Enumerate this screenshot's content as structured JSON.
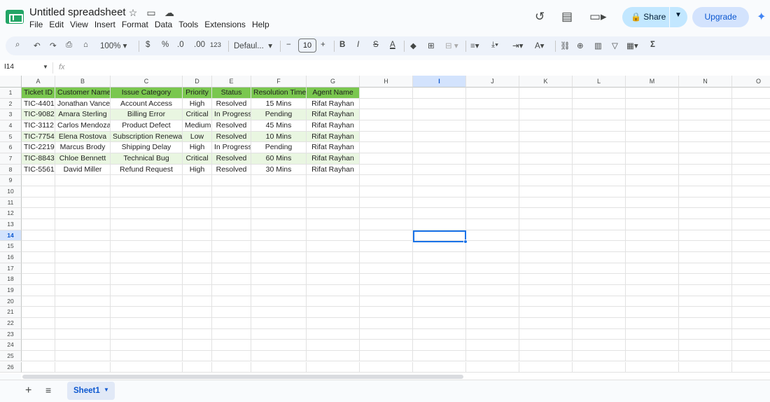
{
  "app": {
    "title": "Untitled spreadsheet",
    "icons": [
      "star-icon",
      "move-to-folder-icon",
      "cloud-saved-icon"
    ],
    "menu": [
      "File",
      "Edit",
      "View",
      "Insert",
      "Format",
      "Data",
      "Tools",
      "Extensions",
      "Help"
    ],
    "share_label": "Share",
    "upgrade_label": "Upgrade",
    "brand_color": "#23a566",
    "accent_color": "#0b57d0"
  },
  "toolbar": {
    "zoom": "100%",
    "currency": "$",
    "percent": "%",
    "dec_decrease": ".0",
    "dec_increase": ".00",
    "number_format": "123",
    "font": "Defaul...",
    "font_size": "10",
    "minus": "−",
    "plus": "+",
    "bold": "B",
    "italic": "I",
    "strike": "S",
    "text_color": "A",
    "sum": "Σ"
  },
  "formula_bar": {
    "name_box": "I14",
    "fx": "fx",
    "value": ""
  },
  "grid": {
    "columns": [
      "A",
      "B",
      "C",
      "D",
      "E",
      "F",
      "G",
      "H",
      "I",
      "J",
      "K",
      "L",
      "M",
      "N",
      "O"
    ],
    "rows": [
      "1",
      "2",
      "3",
      "4",
      "5",
      "6",
      "7",
      "8",
      "9",
      "10",
      "11",
      "12",
      "13",
      "14",
      "15",
      "16",
      "17",
      "18",
      "19",
      "20",
      "21",
      "22",
      "23",
      "24",
      "25",
      "26"
    ],
    "selected_cell": "I14",
    "header_color": "#7ac74f",
    "band_color": "#e9f6e1",
    "headers": [
      "Ticket ID",
      "Customer Name",
      "Issue Category",
      "Priority",
      "Status",
      "Resolution Time",
      "Agent Name"
    ],
    "data": [
      [
        "TIC-4401",
        "Jonathan Vance",
        "Account Access",
        "High",
        "Resolved",
        "15 Mins",
        "Rifat Rayhan"
      ],
      [
        "TIC-9082",
        "Amara Sterling",
        "Billing Error",
        "Critical",
        "In Progress",
        "Pending",
        "Rifat Rayhan"
      ],
      [
        "TIC-3112",
        "Carlos Mendoza",
        "Product Defect",
        "Medium",
        "Resolved",
        "45 Mins",
        "Rifat Rayhan"
      ],
      [
        "TIC-7754",
        "Elena Rostova",
        "Subscription Renewal",
        "Low",
        "Resolved",
        "10 Mins",
        "Rifat Rayhan"
      ],
      [
        "TIC-2219",
        "Marcus Brody",
        "Shipping Delay",
        "High",
        "In Progress",
        "Pending",
        "Rifat Rayhan"
      ],
      [
        "TIC-8843",
        "Chloe Bennett",
        "Technical Bug",
        "Critical",
        "Resolved",
        "60 Mins",
        "Rifat Rayhan"
      ],
      [
        "TIC-5561",
        "David Miller",
        "Refund Request",
        "High",
        "Resolved",
        "30 Mins",
        "Rifat Rayhan"
      ]
    ]
  },
  "sheets": {
    "add": "+",
    "list": "≡",
    "active": "Sheet1"
  }
}
